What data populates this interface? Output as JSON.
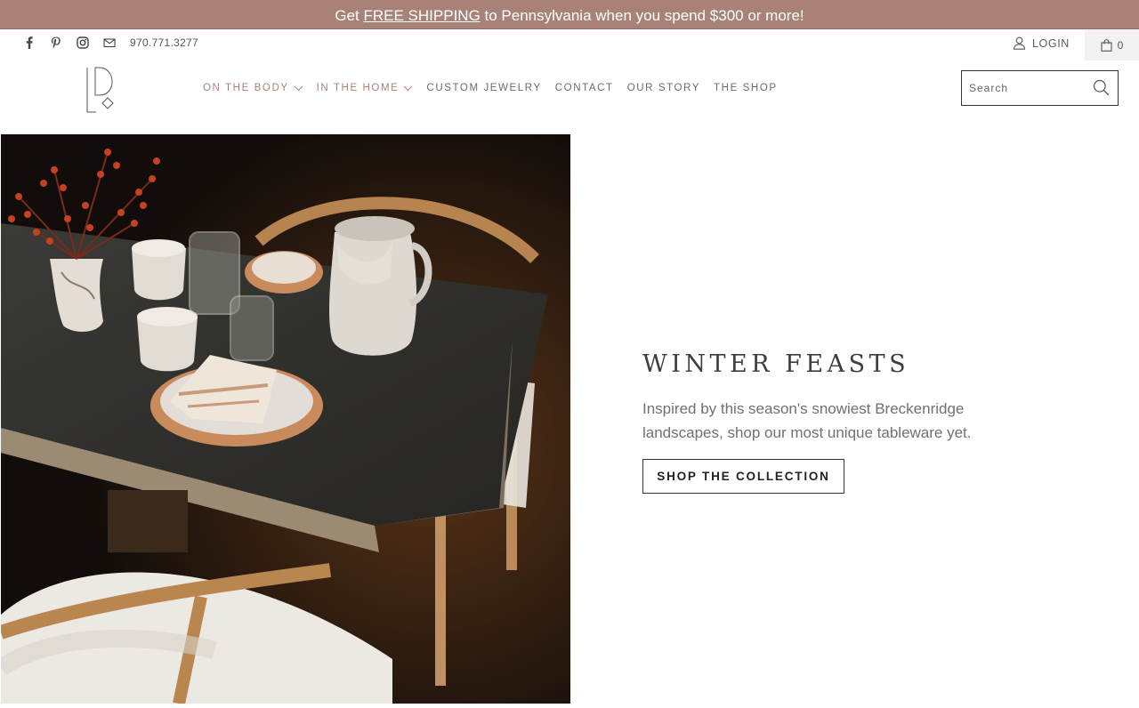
{
  "announcement": {
    "prefix": "Get ",
    "link": "FREE SHIPPING",
    "suffix": " to Pennsylvania when you spend $300 or more!"
  },
  "utility": {
    "social_icons": [
      "facebook-icon",
      "pinterest-icon",
      "instagram-icon",
      "mail-icon"
    ],
    "phone": "970.771.3277",
    "login_label": "LOGIN",
    "cart_count": "0"
  },
  "nav": {
    "items": [
      {
        "label": "ON THE BODY",
        "dropdown": true
      },
      {
        "label": "IN THE HOME",
        "dropdown": true
      },
      {
        "label": "CUSTOM JEWELRY",
        "dropdown": false
      },
      {
        "label": "CONTACT",
        "dropdown": false
      },
      {
        "label": "OUR STORY",
        "dropdown": false
      },
      {
        "label": "THE SHOP",
        "dropdown": false
      }
    ]
  },
  "search": {
    "placeholder": "Search"
  },
  "hero": {
    "title": "WINTER FEASTS",
    "description": "Inspired by this season's snowiest Breckenridge landscapes, shop our most unique tableware yet.",
    "cta_label": "SHOP THE COLLECTION"
  },
  "colors": {
    "announcement_bg": "#a98277",
    "nav_accent": "#a98277",
    "text_dark": "#3d3d3d"
  }
}
